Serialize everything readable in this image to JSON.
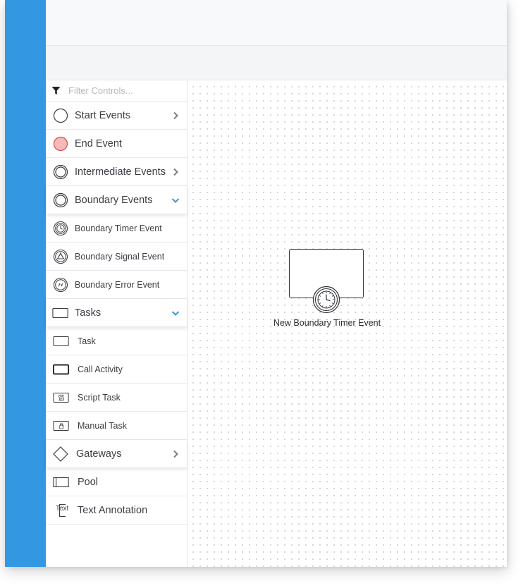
{
  "filter": {
    "placeholder": "Filter Controls..."
  },
  "sidebar": {
    "items": [
      {
        "label": "Start Events",
        "icon": "circle-icon",
        "chevron": "right"
      },
      {
        "label": "End Event",
        "icon": "end-event-icon"
      },
      {
        "label": "Intermediate Events",
        "icon": "double-circle-icon",
        "chevron": "right"
      },
      {
        "label": "Boundary Events",
        "icon": "double-circle-icon",
        "chevron": "down"
      },
      {
        "label": "Boundary Timer Event",
        "icon": "timer-icon"
      },
      {
        "label": "Boundary Signal Event",
        "icon": "signal-icon"
      },
      {
        "label": "Boundary Error Event",
        "icon": "error-icon"
      },
      {
        "label": "Tasks",
        "icon": "task-rect-icon",
        "chevron": "down"
      },
      {
        "label": "Task",
        "icon": "task-rect-icon"
      },
      {
        "label": "Call Activity",
        "icon": "call-activity-icon"
      },
      {
        "label": "Script Task",
        "icon": "script-task-icon"
      },
      {
        "label": "Manual Task",
        "icon": "manual-task-icon"
      },
      {
        "label": "Gateways",
        "icon": "diamond-icon",
        "chevron": "right"
      },
      {
        "label": "Pool",
        "icon": "pool-icon"
      },
      {
        "label": "Text Annotation",
        "icon": "text-annotation-icon",
        "icon_text": "Text"
      }
    ]
  },
  "canvas": {
    "element_label": "New Boundary Timer Event"
  },
  "colors": {
    "accent": "#3497e2",
    "end_event_fill": "#f6b9b9",
    "end_event_stroke": "#d24b4b",
    "chevron_down": "#3497e2",
    "chevron_right": "#7b7f85"
  }
}
